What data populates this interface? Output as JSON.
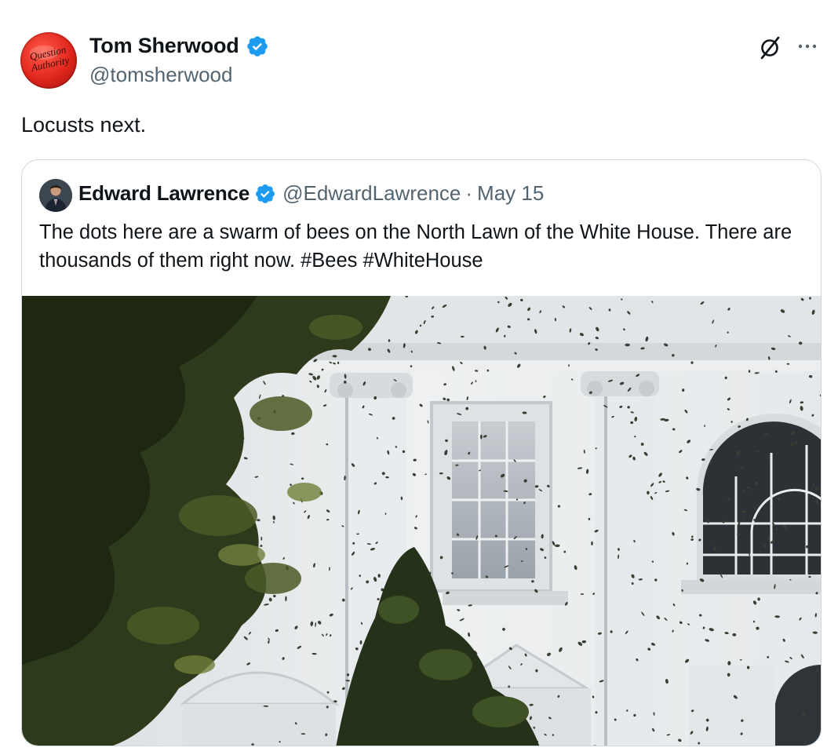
{
  "tweet": {
    "author": {
      "name": "Tom Sherwood",
      "handle": "@tomsherwood",
      "verified": true,
      "avatar_icon": "question-authority-button-avatar",
      "avatar_text_line1": "Question",
      "avatar_text_line2": "Authority"
    },
    "text": "Locusts next.",
    "actions": {
      "grok_icon": "grok-icon",
      "more_icon": "more-icon"
    }
  },
  "quoted_tweet": {
    "author": {
      "name": "Edward Lawrence",
      "handle": "@EdwardLawrence",
      "verified": true,
      "avatar_icon": "person-portrait-avatar"
    },
    "separator": "·",
    "date": "May 15",
    "text": "The dots here are a swarm of bees on the North Lawn of the White House. There are thousands of them right now. #Bees #WhiteHouse",
    "media": {
      "type": "photo",
      "icon": "white-house-bees-photo"
    }
  },
  "colors": {
    "text_primary": "#0f1419",
    "text_secondary": "#536471",
    "verified_blue": "#1d9bf0",
    "border": "#cfd9de",
    "avatar_red": "#e0261c"
  }
}
